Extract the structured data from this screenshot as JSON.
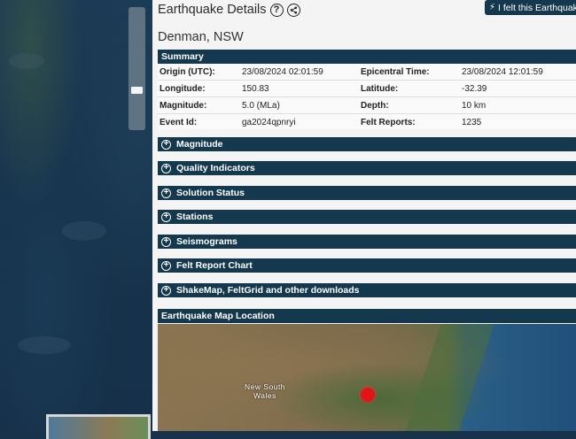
{
  "header": {
    "title": "Earthquake Details",
    "help_icon": "question-icon",
    "share_icon": "share-icon",
    "felt_button_label": "I felt this Earthquake",
    "felt_button_icon": "lightning-bolt-icon",
    "location": "Denman, NSW"
  },
  "summary": {
    "heading": "Summary",
    "rows": [
      {
        "k1": "Origin (UTC):",
        "v1": "23/08/2024 02:01:59",
        "k2": "Epicentral Time:",
        "v2": "23/08/2024 12:01:59"
      },
      {
        "k1": "Longitude:",
        "v1": "150.83",
        "k2": "Latitude:",
        "v2": "-32.39"
      },
      {
        "k1": "Magnitude:",
        "v1": "5.0 (MLa)",
        "k2": "Depth:",
        "v2": "10 km"
      },
      {
        "k1": "Event Id:",
        "v1": "ga2024qpnryi",
        "k2": "Felt Reports:",
        "v2": "1235"
      }
    ]
  },
  "sections": [
    "Magnitude",
    "Quality Indicators",
    "Solution Status",
    "Stations",
    "Seismograms",
    "Felt Report Chart",
    "ShakeMap, FeltGrid and other downloads"
  ],
  "map": {
    "heading": "Earthquake Map Location",
    "region_label_line1": "New South",
    "region_label_line2": "Wales",
    "marker_color": "#e01616"
  },
  "colors": {
    "bar": "#14384e",
    "panel_bg": "#f4f4f4"
  }
}
